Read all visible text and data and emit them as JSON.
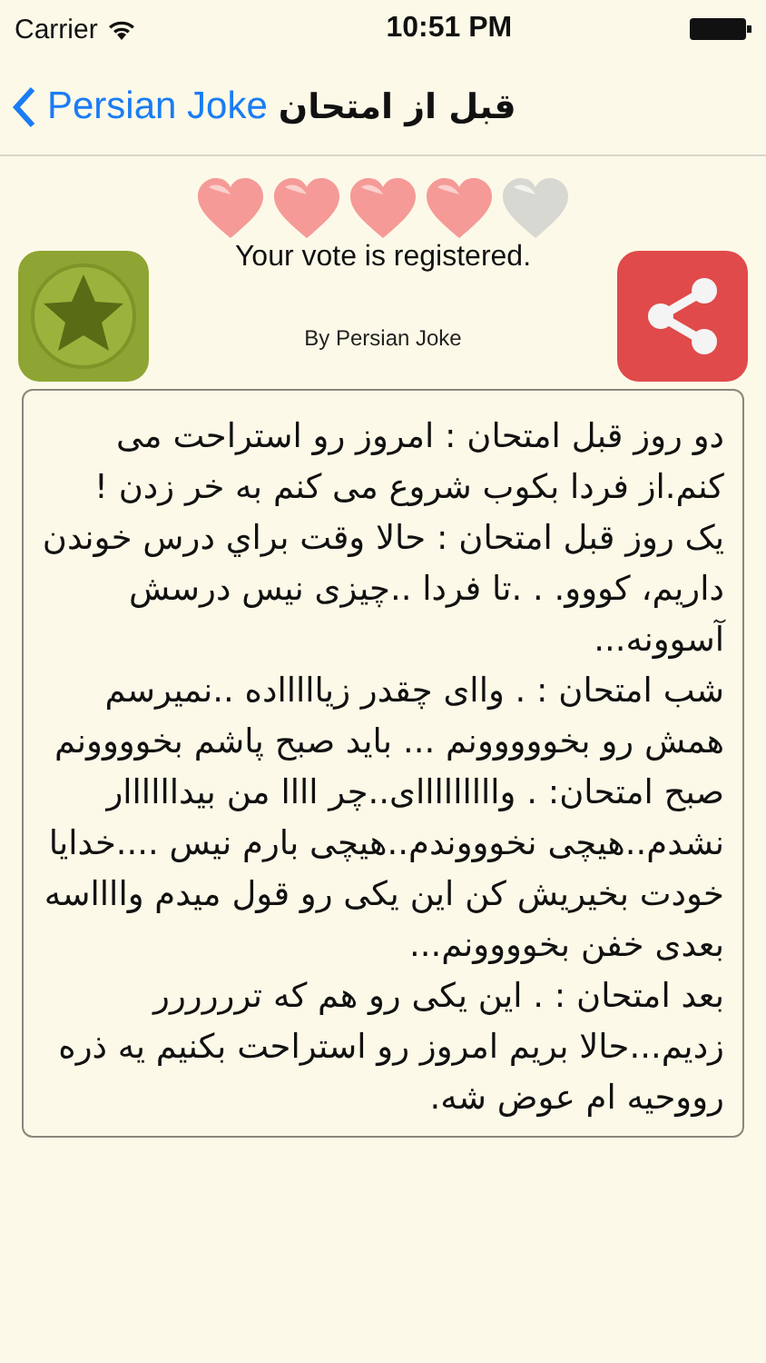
{
  "status_bar": {
    "carrier": "Carrier",
    "time": "10:51 PM"
  },
  "nav": {
    "back_label": "Persian Joke",
    "title": "قبل از امتحان"
  },
  "rating": {
    "stars": 4,
    "message": "Your vote is registered."
  },
  "author": "By Persian Joke",
  "joke": [
    "دو روز قبل امتحان : امروز رو استراحت می کنم.از فردا بکوب شروع می کنم به خر زدن !",
    "یک روز قبل امتحان : حالا وقت براي درس خوندن داریم، کووو. . .تا فردا ..چیزی نیس درسش آسوونه...",
    "شب امتحان : . واای چقدر زیاااااده ..نمیرسم همش رو بخووووونم ... باید صبح پاشم بخوووونم",
    "صبح امتحان: . وااااااااای..چر اااا من بیداااااار نشدم..هیچی نخوووندم..هیچی بارم نیس ....خدایا خودت بخیریش کن این یکی رو قول میدم وااااسه بعدی خفن بخوووونم...",
    "بعد امتحان : . این یکی رو هم که ترررررر زدیم...حالا بریم امروز رو استراحت بکنیم یه ذره رووحیه ام عوض شه."
  ]
}
